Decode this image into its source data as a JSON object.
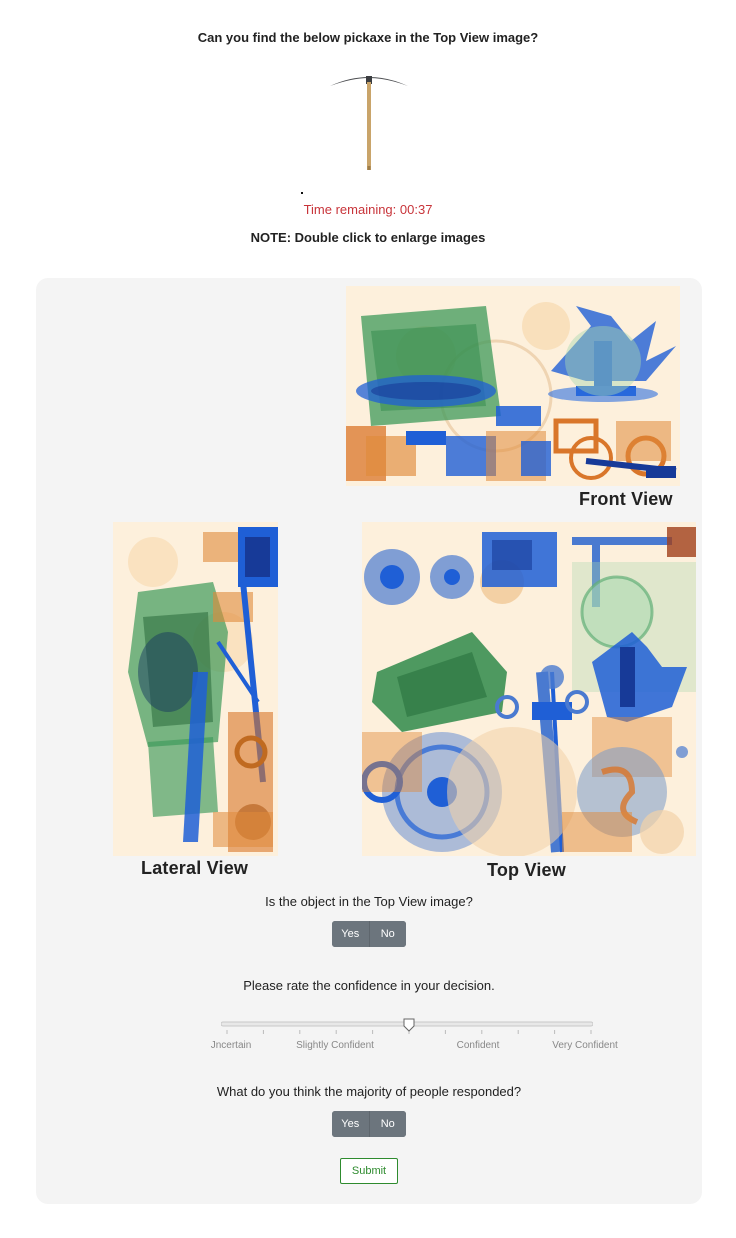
{
  "header": {
    "prompt": "Can you find the below pickaxe in the Top View image?",
    "timer": "Time remaining: 00:37",
    "note": "NOTE: Double click to enlarge images"
  },
  "views": {
    "front_label": "Front View",
    "lateral_label": "Lateral View",
    "top_label": "Top View"
  },
  "q1": {
    "text": "Is the object in the Top View image?",
    "yes": "Yes",
    "no": "No"
  },
  "confidence": {
    "text": "Please rate the confidence in your decision.",
    "labels": [
      "Jncertain",
      "Slightly Confident",
      "Confident",
      "Very Confident"
    ],
    "value_fraction": 0.5
  },
  "q2": {
    "text": "What do you think the majority of people responded?",
    "yes": "Yes",
    "no": "No"
  },
  "submit_label": "Submit",
  "colors": {
    "timer": "#c8343a",
    "panel": "#f4f4f4",
    "button": "#6c757d",
    "submit": "#2e8b2e",
    "xray_organic": "#e08a3a",
    "xray_inorganic": "#3d9a5a",
    "xray_metal": "#1f5fd6"
  }
}
